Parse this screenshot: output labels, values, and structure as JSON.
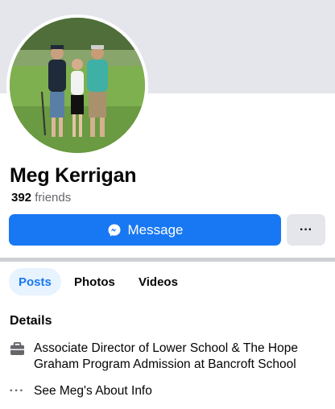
{
  "profile": {
    "name": "Meg Kerrigan",
    "friends_count": "392",
    "friends_label": "friends",
    "avatar_icon": "profile-photo"
  },
  "actions": {
    "message_label": "Message",
    "message_icon": "messenger-icon",
    "more_label": "···"
  },
  "tabs": [
    {
      "label": "Posts",
      "active": true
    },
    {
      "label": "Photos",
      "active": false
    },
    {
      "label": "Videos",
      "active": false
    }
  ],
  "details": {
    "title": "Details",
    "work_icon": "briefcase-icon",
    "work_text": "Associate Director of Lower School & The Hope Graham Program Admission at Bancroft School",
    "about_icon": "more-dots-icon",
    "about_dots": "···",
    "about_text": "See Meg's About Info"
  },
  "colors": {
    "accent": "#1877f2",
    "active_tab_bg": "#e7f3ff",
    "secondary_button_bg": "#e4e6eb",
    "muted_text": "#65676b"
  }
}
